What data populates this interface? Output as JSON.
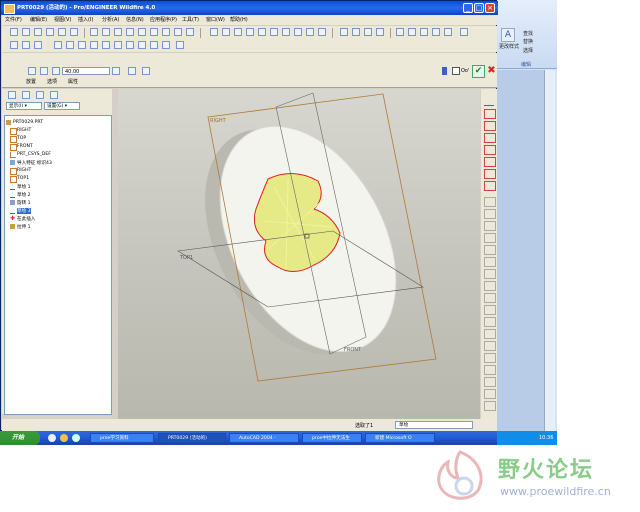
{
  "window": {
    "title": "PRT0029 (活动的) - Pro/ENGINEER Wildfire 4.0"
  },
  "menubar": [
    "文件(F)",
    "编辑(E)",
    "视图(V)",
    "插入(I)",
    "分析(A)",
    "信息(N)",
    "应用程序(P)",
    "工具(T)",
    "窗口(W)",
    "帮助(H)"
  ],
  "dashboard": {
    "depth_value": "40.00",
    "tabs": [
      "放置",
      "选项",
      "属性"
    ],
    "preview_label": "Oo'"
  },
  "model_tree": {
    "show_label": "显示(I) ▾",
    "settings_label": "设置(G) ▾",
    "items": [
      {
        "label": "PRT0029.PRT",
        "icon": "part-icon"
      },
      {
        "label": "RIGHT",
        "icon": "datum-plane-icon"
      },
      {
        "label": "TOP",
        "icon": "datum-plane-icon"
      },
      {
        "label": "FRONT",
        "icon": "datum-plane-icon"
      },
      {
        "label": "PRT_CSYS_DEF",
        "icon": "csys-icon"
      },
      {
        "label": "导入特征 标识43",
        "icon": "import-feature-icon"
      },
      {
        "label": "RIGHT",
        "icon": "datum-plane-icon"
      },
      {
        "label": "TOP1",
        "icon": "datum-plane-icon"
      },
      {
        "label": "草绘 1",
        "icon": "sketch-icon"
      },
      {
        "label": "草绘 2",
        "icon": "sketch-icon"
      },
      {
        "label": "旋转 1",
        "icon": "revolve-icon"
      },
      {
        "label": "草绘 3",
        "icon": "sketch-icon"
      },
      {
        "label": "在此插入",
        "icon": "insert-here-icon"
      },
      {
        "label": "拉伸 1",
        "icon": "extrude-icon"
      }
    ]
  },
  "graphics": {
    "datum_labels": [
      "RIGHT",
      "TOP1",
      "FRONT"
    ]
  },
  "status": {
    "selected_text": "选取了1",
    "filter_value": "草绘"
  },
  "taskbar": {
    "start_label": "开始",
    "tasks": [
      "proe学习资料",
      "PRT0029 (活动的)",
      "AutoCAD 2004 -",
      "proe中拉伸无法生",
      "新建 Microsoft O"
    ],
    "tray_time": "10:36"
  },
  "word": {
    "buttons": [
      "查找",
      "替换",
      "选择"
    ],
    "group": "编辑",
    "style_label": "更改样式"
  },
  "watermark": {
    "name": "野火论坛",
    "url": "www.proewildfire.cn"
  }
}
